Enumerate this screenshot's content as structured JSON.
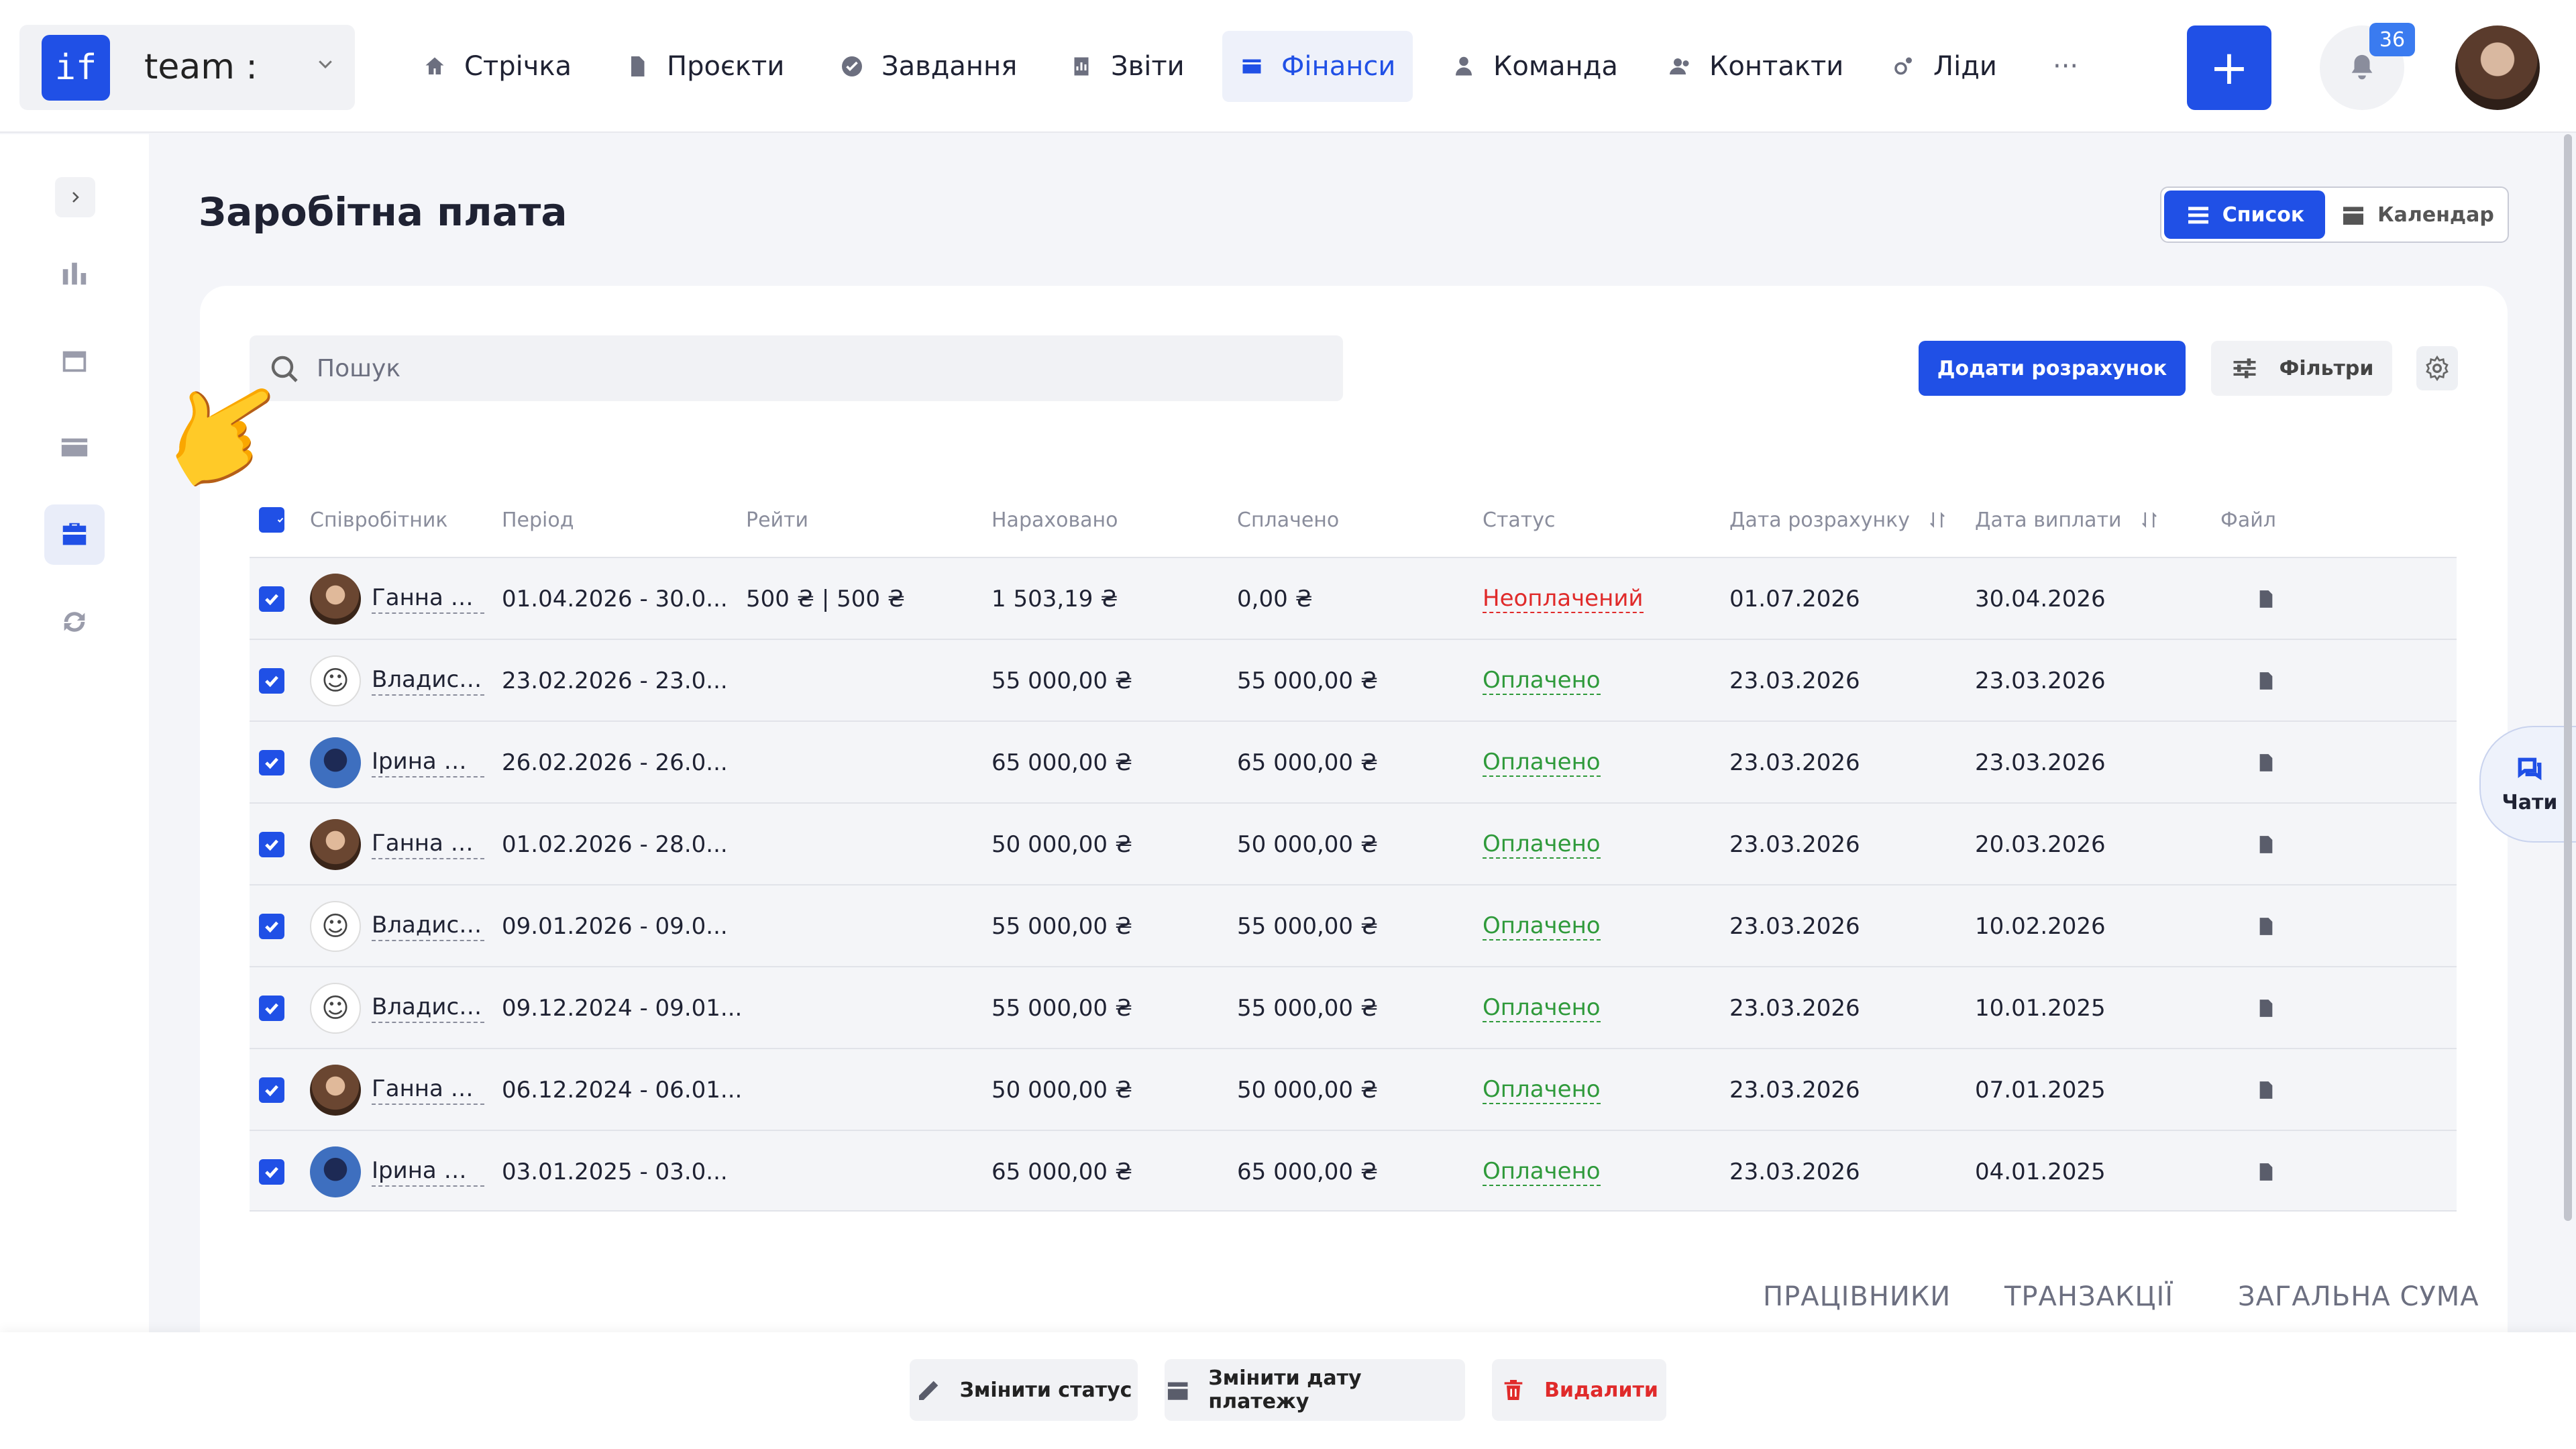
{
  "brand": {
    "logo_text": "if",
    "name": "team :"
  },
  "nav": [
    {
      "label": "Стрічка",
      "icon": "home-icon"
    },
    {
      "label": "Проєкти",
      "icon": "document-icon"
    },
    {
      "label": "Завдання",
      "icon": "check-circle-icon"
    },
    {
      "label": "Звіти",
      "icon": "report-icon"
    },
    {
      "label": "Фінанси",
      "icon": "wallet-icon",
      "active": true
    },
    {
      "label": "Команда",
      "icon": "user-icon"
    },
    {
      "label": "Контакти",
      "icon": "contacts-icon"
    },
    {
      "label": "Ліди",
      "icon": "leads-icon"
    }
  ],
  "nav_more": "···",
  "notifications": {
    "count": "36"
  },
  "page": {
    "title": "Заробітна плата"
  },
  "view_toggle": {
    "list": "Список",
    "calendar": "Календар"
  },
  "search": {
    "placeholder": "Пошук"
  },
  "actions": {
    "add": "Додати розрахунок",
    "filters": "Фільтри"
  },
  "table": {
    "headers": {
      "employee": "Співробітник",
      "period": "Період",
      "rates": "Рейти",
      "accrued": "Нараховано",
      "paid": "Сплачено",
      "status": "Статус",
      "calc_date": "Дата розрахунку",
      "pay_date": "Дата виплати",
      "file": "Файл"
    },
    "rows": [
      {
        "employee": "Ганна Пі...",
        "avatar": "hanna",
        "period": "01.04.2026 - 30.0...",
        "rates": "500 ₴ | 500 ₴",
        "accrued": "1 503,19 ₴",
        "paid": "0,00 ₴",
        "status": "Неоплачений",
        "status_type": "unpaid",
        "calc_date": "01.07.2026",
        "pay_date": "30.04.2026"
      },
      {
        "employee": "Владисл...",
        "avatar": "vlad",
        "period": "23.02.2026 - 23.0...",
        "rates": "",
        "accrued": "55 000,00 ₴",
        "paid": "55 000,00 ₴",
        "status": "Оплачено",
        "status_type": "paid",
        "calc_date": "23.03.2026",
        "pay_date": "23.03.2026"
      },
      {
        "employee": "Ірина Ме...",
        "avatar": "iryna",
        "period": "26.02.2026 - 26.0...",
        "rates": "",
        "accrued": "65 000,00 ₴",
        "paid": "65 000,00 ₴",
        "status": "Оплачено",
        "status_type": "paid",
        "calc_date": "23.03.2026",
        "pay_date": "23.03.2026"
      },
      {
        "employee": "Ганна Пі...",
        "avatar": "hanna",
        "period": "01.02.2026 - 28.0...",
        "rates": "",
        "accrued": "50 000,00 ₴",
        "paid": "50 000,00 ₴",
        "status": "Оплачено",
        "status_type": "paid",
        "calc_date": "23.03.2026",
        "pay_date": "20.03.2026"
      },
      {
        "employee": "Владисл...",
        "avatar": "vlad",
        "period": "09.01.2026 - 09.0...",
        "rates": "",
        "accrued": "55 000,00 ₴",
        "paid": "55 000,00 ₴",
        "status": "Оплачено",
        "status_type": "paid",
        "calc_date": "23.03.2026",
        "pay_date": "10.02.2026"
      },
      {
        "employee": "Владисл...",
        "avatar": "vlad",
        "period": "09.12.2024 - 09.01...",
        "rates": "",
        "accrued": "55 000,00 ₴",
        "paid": "55 000,00 ₴",
        "status": "Оплачено",
        "status_type": "paid",
        "calc_date": "23.03.2026",
        "pay_date": "10.01.2025"
      },
      {
        "employee": "Ганна Пі...",
        "avatar": "hanna",
        "period": "06.12.2024 - 06.01...",
        "rates": "",
        "accrued": "50 000,00 ₴",
        "paid": "50 000,00 ₴",
        "status": "Оплачено",
        "status_type": "paid",
        "calc_date": "23.03.2026",
        "pay_date": "07.01.2025"
      },
      {
        "employee": "Ірина Ме...",
        "avatar": "iryna",
        "period": "03.01.2025 - 03.0...",
        "rates": "",
        "accrued": "65 000,00 ₴",
        "paid": "65 000,00 ₴",
        "status": "Оплачено",
        "status_type": "paid",
        "calc_date": "23.03.2026",
        "pay_date": "04.01.2025"
      }
    ]
  },
  "bottom_tabs": {
    "workers": "ПРАЦІВНИКИ",
    "transactions": "ТРАНЗАКЦІЇ",
    "total": "ЗАГАЛЬНА СУМА"
  },
  "bulk_actions": {
    "change_status": "Змінити статус",
    "change_date": "Змінити дату платежу",
    "delete": "Видалити"
  },
  "chat": {
    "label": "Чати"
  },
  "colors": {
    "accent": "#2050e6",
    "paid": "#2f9a3b",
    "unpaid": "#e02a2a"
  }
}
